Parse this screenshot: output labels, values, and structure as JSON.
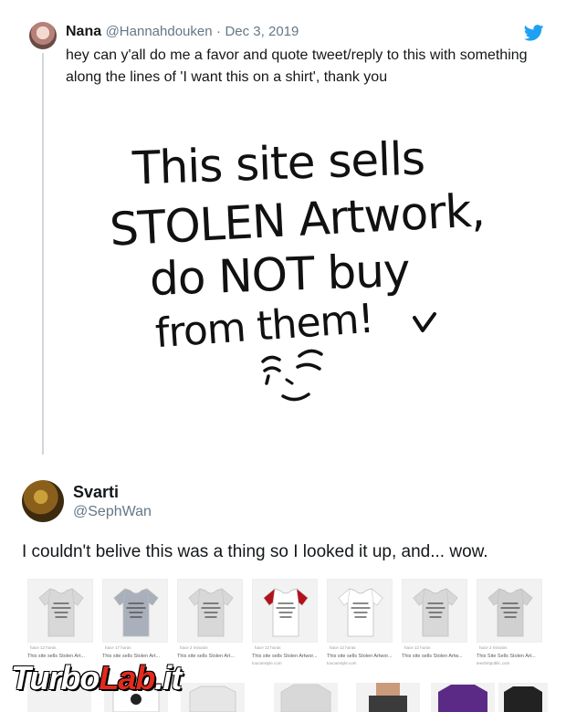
{
  "quoted_tweet": {
    "name": "Nana",
    "handle": "@Hannahdouken",
    "separator": "·",
    "date": "Dec 3, 2019",
    "text": "hey can y'all do me a favor and quote tweet/reply to this with something along the lines of 'I want this on a shirt', thank you",
    "icon": "twitter-bird-icon",
    "brand_color": "#1da1f2"
  },
  "artwork": {
    "lines": [
      "This site sells",
      "STOLEN Artwork,",
      "do NOT buy",
      "from them!"
    ]
  },
  "reply_tweet": {
    "name": "Svarti",
    "handle": "@SephWan",
    "text": "I couldn't belive this was a thing so I looked it up, and... wow."
  },
  "products": [
    {
      "caption": "This site sells Stolen Art...",
      "meta": "hace 12 horas",
      "shirt_color": "#d8d8d8"
    },
    {
      "caption": "This site sells Stolen Art...",
      "meta": "hace 17 horas",
      "shirt_color": "#a9b0bb"
    },
    {
      "caption": "This site sells Stolen Art...",
      "meta": "hace 2 minutos",
      "shirt_color": "#d8d8d8"
    },
    {
      "caption": "This site sells Stolen Artwor...",
      "meta": "hace 12 horas",
      "shirt_color": "#ffffff",
      "sleeve_color": "#b3121a",
      "sub": "toucanstyle.com"
    },
    {
      "caption": "This site sells Stolen Artwor...",
      "meta": "hace 12 horas",
      "shirt_color": "#ffffff",
      "sub": "toucanstyle.com"
    },
    {
      "caption": "This site sells Stolen Artw...",
      "meta": "hace 12 horas",
      "shirt_color": "#d8d8d8"
    },
    {
      "caption": "This Site Sells Stolen Art...",
      "meta": "hace 2 minutos",
      "shirt_color": "#d0d0d0",
      "sub": "teeshirtpublic.com"
    }
  ],
  "watermark": {
    "part1": "Turbo",
    "part2": "Lab",
    "part3": ".it"
  }
}
